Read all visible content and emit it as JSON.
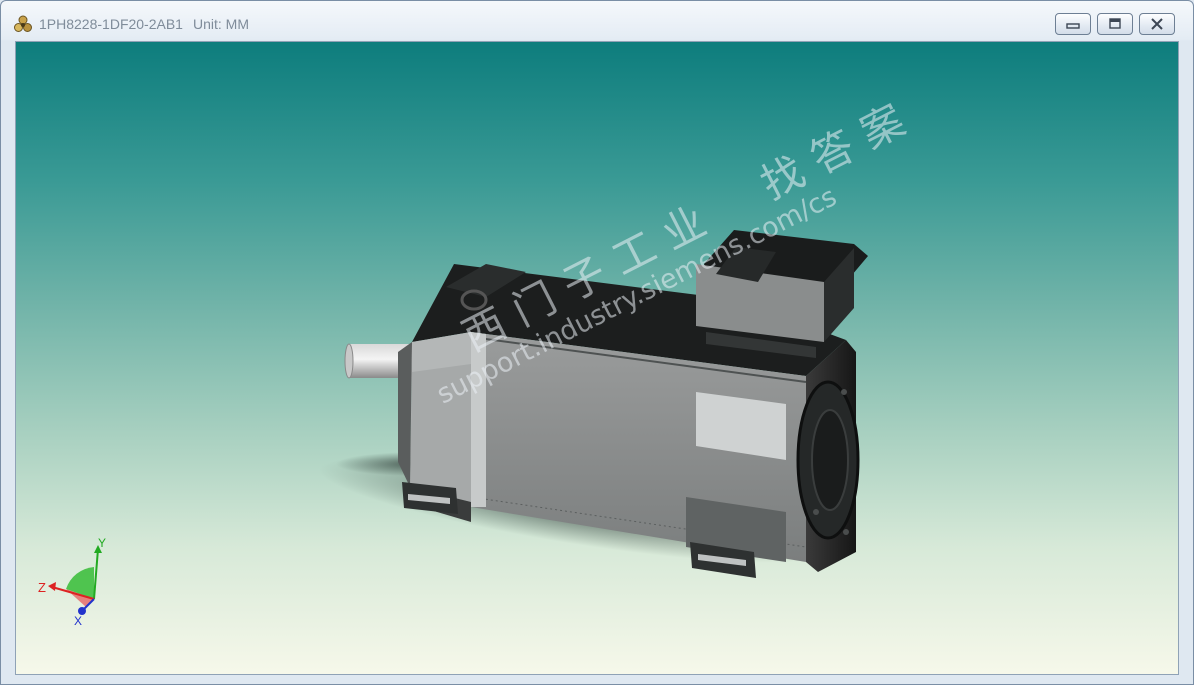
{
  "window": {
    "title": "1PH8228-1DF20-2AB1",
    "unit_label": "Unit: MM",
    "icon": "model-viewer-app-icon",
    "controls": {
      "minimize_icon": "minimize-icon",
      "maximize_icon": "maximize-icon",
      "close_icon": "close-icon"
    }
  },
  "viewport": {
    "background_top": "#0d7d7d",
    "background_bottom": "#f6f8ea",
    "model": "3d-motor-model",
    "watermark": {
      "line1": "西门子工业  找答案",
      "line2": "support.industry.siemens.com/cs"
    },
    "axis_triad": {
      "x": "X",
      "y": "Y",
      "z": "Z",
      "colors": {
        "x": "#2233cc",
        "y": "#22aa22",
        "z": "#dd2222"
      }
    }
  }
}
